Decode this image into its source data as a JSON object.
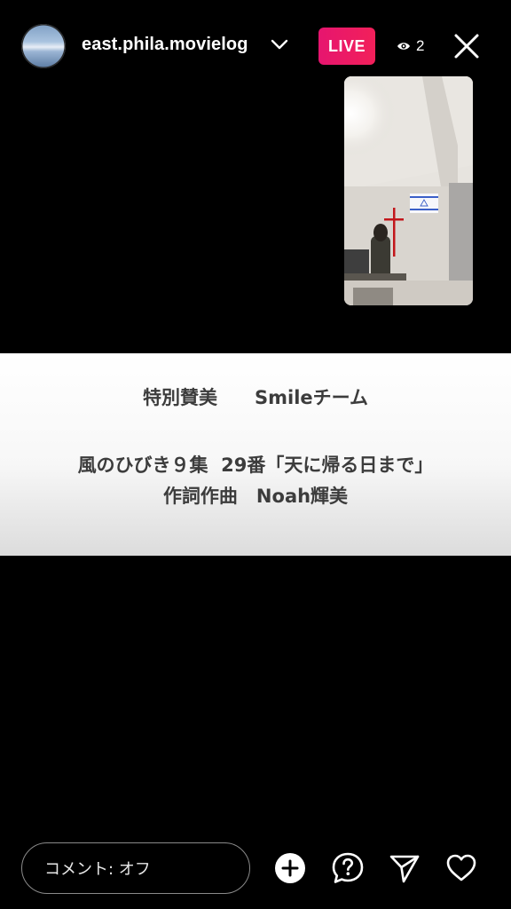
{
  "header": {
    "username": "east.phila.movielog",
    "live_label": "LIVE",
    "viewer_count": "2"
  },
  "banner": {
    "line1": "特別賛美　　Smileチーム",
    "line2": "風のひびき９集  29番「天に帰る日まで」",
    "line3": "作詞作曲　Noah輝美"
  },
  "footer": {
    "comment_placeholder": "コメント: オフ"
  },
  "colors": {
    "live_badge": "#e6156f",
    "background": "#000000",
    "banner_text": "#3c3c3c"
  },
  "icons": [
    "avatar",
    "chevron-down-icon",
    "eye-icon",
    "close-icon",
    "add-icon",
    "question-icon",
    "send-icon",
    "heart-icon"
  ]
}
